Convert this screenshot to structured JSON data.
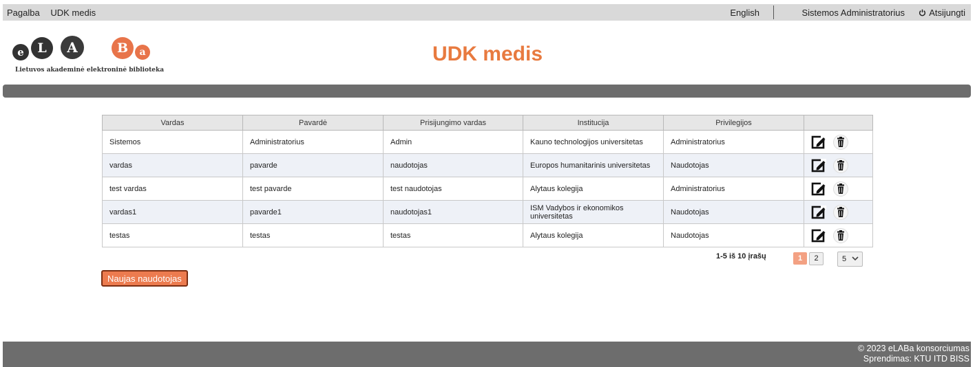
{
  "topbar": {
    "nav": [
      "Pagalba",
      "UDK medis"
    ],
    "language": "English",
    "user": "Sistemos Administratorius",
    "logout": "Atsijungti"
  },
  "logo": {
    "letters": [
      "e",
      "L",
      "A",
      "B",
      "a"
    ],
    "tagline": "Lietuvos akademinė elektroninė biblioteka"
  },
  "page_title": "UDK medis",
  "table": {
    "headers": [
      "Vardas",
      "Pavardė",
      "Prisijungimo vardas",
      "Institucija",
      "Privilegijos",
      ""
    ],
    "rows": [
      [
        "Sistemos",
        "Administratorius",
        "Admin",
        "Kauno technologijos universitetas",
        "Administratorius"
      ],
      [
        "vardas",
        "pavarde",
        "naudotojas",
        "Europos humanitarinis universitetas",
        "Naudotojas"
      ],
      [
        "test vardas",
        "test pavarde",
        "test naudotojas",
        "Alytaus kolegija",
        "Administratorius"
      ],
      [
        "vardas1",
        "pavarde1",
        "naudotojas1",
        "ISM Vadybos ir ekonomikos universitetas",
        "Naudotojas"
      ],
      [
        "testas",
        "testas",
        "testas",
        "Alytaus kolegija",
        "Naudotojas"
      ]
    ]
  },
  "pager": {
    "count_text": "1-5 iš 10 įrašų",
    "pages": [
      "1",
      "2"
    ],
    "page_size": "5"
  },
  "new_user_button": "Naujas naudotojas",
  "footer": {
    "copyright": "© 2023 eLABa konsorciumas",
    "solution": "Sprendimas: KTU ITD BISS"
  },
  "colors": {
    "accent": "#e87a3f",
    "button": "#ec7b4f",
    "bar": "#6d6d6d"
  }
}
